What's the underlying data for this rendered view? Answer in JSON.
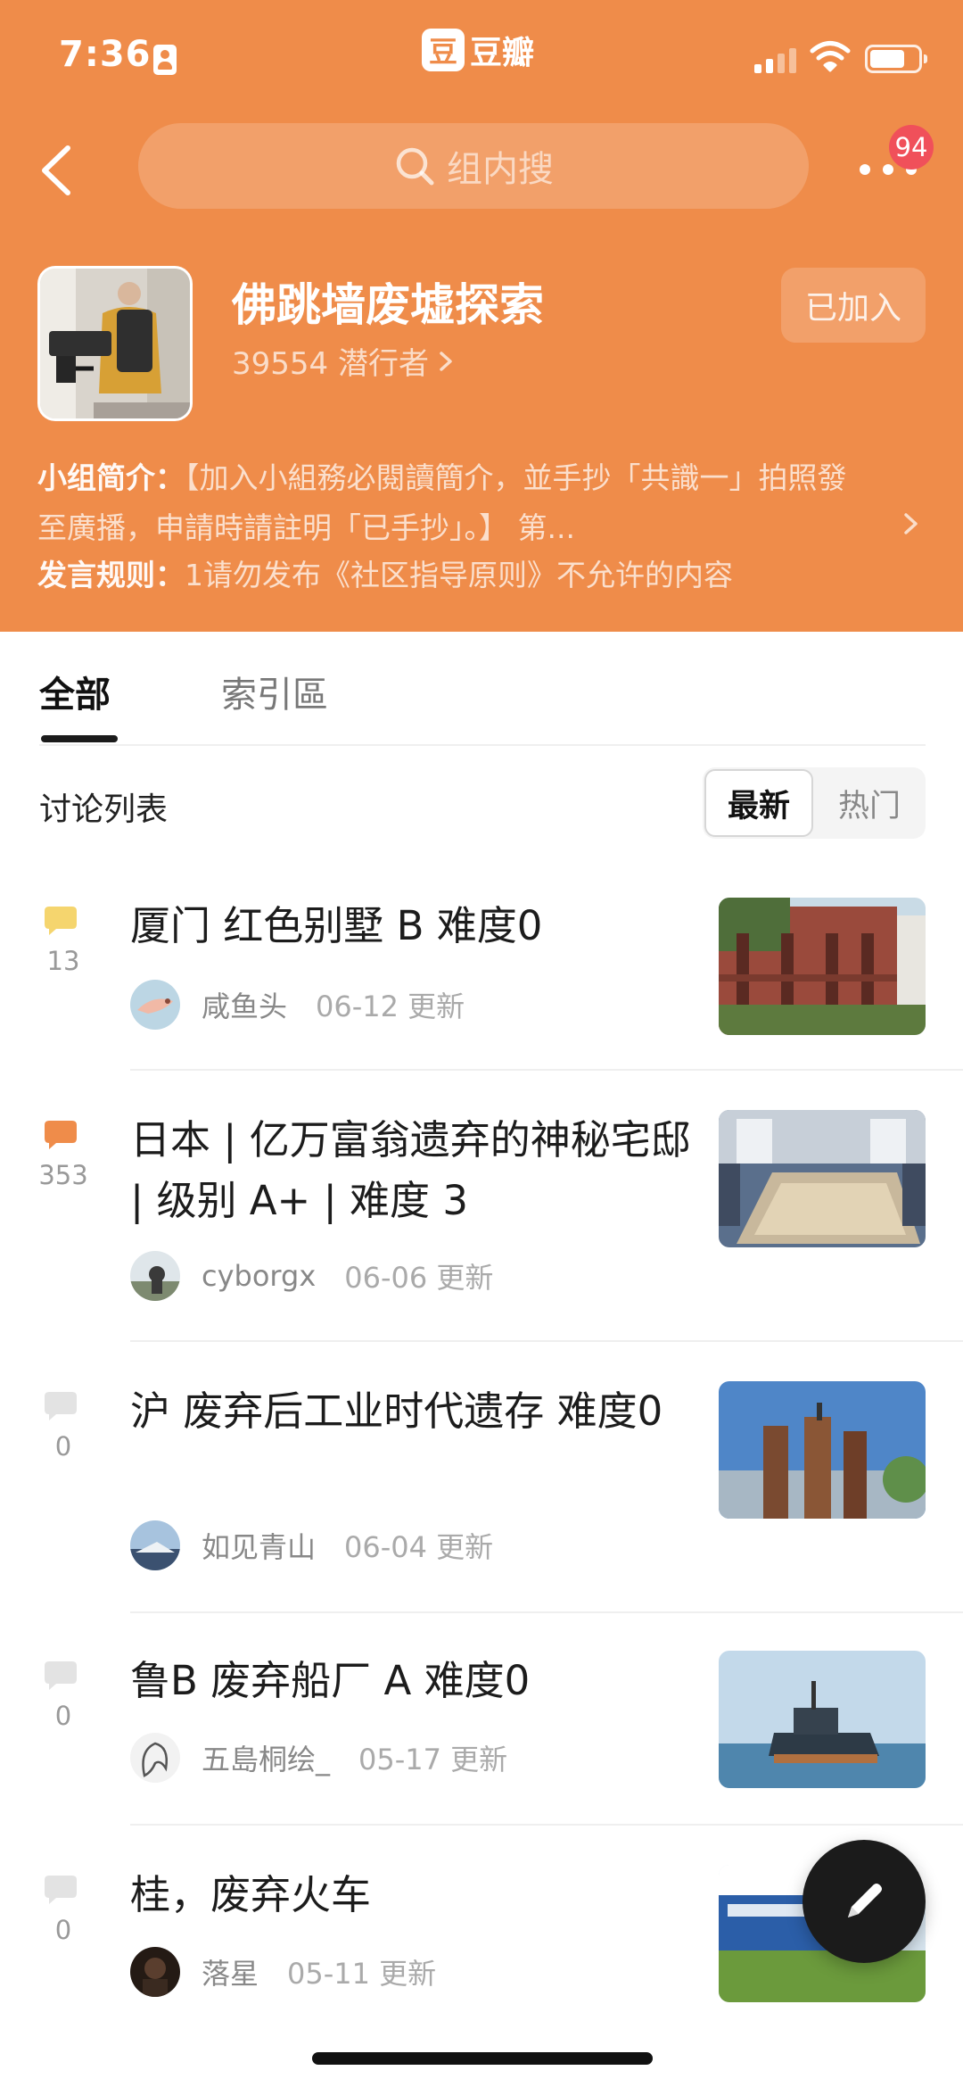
{
  "status_bar": {
    "time": "7:36"
  },
  "app": {
    "logo_mark": "豆",
    "logo_text": "豆瓣"
  },
  "search": {
    "placeholder": "组内搜"
  },
  "notifications": {
    "badge": "94"
  },
  "group": {
    "name": "佛跳墙废墟探索",
    "members": "39554 潜行者",
    "join_label": "已加入",
    "intro_label": "小组简介：",
    "intro_text": "【加入小組務必閱讀簡介，並手抄「共識一」拍照發至廣播，申請時請註明「已手抄」。】 第...",
    "rules_label": "发言规则：",
    "rules_text": "1请勿发布《社区指导原则》不允许的内容"
  },
  "tabs": [
    {
      "label": "全部",
      "active": true
    },
    {
      "label": "索引區",
      "active": false
    }
  ],
  "list": {
    "title": "讨论列表",
    "sort_latest": "最新",
    "sort_hot": "热门"
  },
  "posts": [
    {
      "title": "厦门 红色别墅  B  难度0",
      "count": "13",
      "icon_color": "#f5d56e",
      "author": "咸鱼头",
      "date": "06-12 更新"
    },
    {
      "title": "日本 | 亿万富翁遗弃的神秘宅邸 | 级别 A+ | 难度 3",
      "count": "353",
      "icon_color": "#ef8c4a",
      "author": "cyborgx",
      "date": "06-06 更新"
    },
    {
      "title": "沪 废弃后工业时代遗存 难度0",
      "count": "0",
      "icon_color": "#e3e3e3",
      "author": "如见青山",
      "date": "06-04 更新"
    },
    {
      "title": "鲁B 废弃船厂 A 难度0",
      "count": "0",
      "icon_color": "#e3e3e3",
      "author": "五島桐绘_",
      "date": "05-17 更新"
    },
    {
      "title": "桂，废弃火车",
      "count": "0",
      "icon_color": "#e3e3e3",
      "author": "落星",
      "date": "05-11 更新"
    }
  ],
  "icons": {
    "back": "chevron-left-icon",
    "search": "search-icon",
    "more": "more-dots-icon",
    "comment": "comment-bubble-icon",
    "compose": "pencil-icon"
  }
}
